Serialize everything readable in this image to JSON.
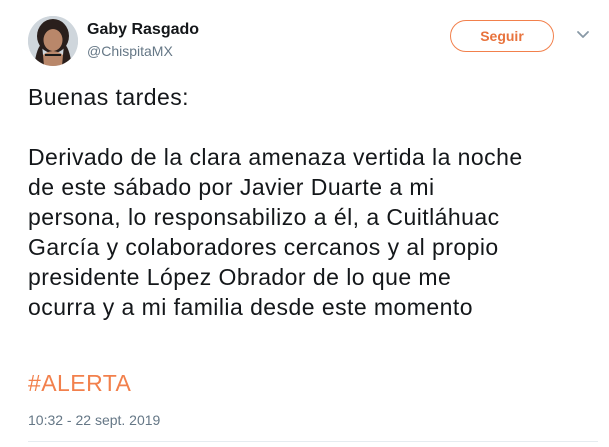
{
  "tweet": {
    "author": {
      "display_name": "Gaby Rasgado",
      "handle": "@ChispitaMX",
      "avatar_icon": "profile-photo"
    },
    "follow_label": "Seguir",
    "menu_icon": "chevron-down-icon",
    "text_lines": [
      "Buenas tardes:",
      "Derivado de la clara amenaza vertida la noche",
      "de este sábado por Javier Duarte a mi",
      "persona, lo responsabilizo a él, a Cuitláhuac",
      "García y colaboradores cercanos y al propio",
      "presidente López Obrador de lo que me",
      "ocurra y a mi familia desde este momento"
    ],
    "hashtag": "#ALERTA",
    "timestamp": "10:32 - 22 sept. 2019"
  },
  "colors": {
    "accent": "#f2804c",
    "text": "#14171a",
    "secondary": "#657786"
  }
}
